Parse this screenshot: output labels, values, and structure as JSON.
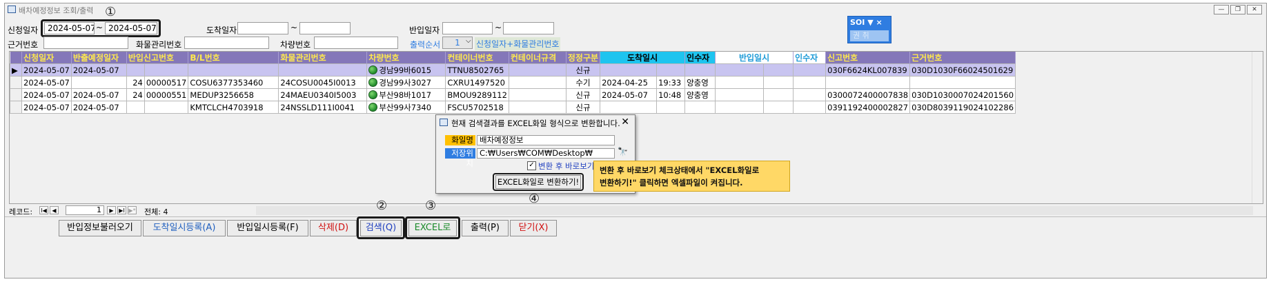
{
  "window": {
    "title": "배차예정정보 조회/출력",
    "controls": [
      "—",
      "❐",
      "✕"
    ]
  },
  "callouts": {
    "c1": "①",
    "c2": "②",
    "c3": "③",
    "c4": "④"
  },
  "filters": {
    "apply_date_label": "신청일자",
    "apply_date_from": "2024-05-07",
    "range_sep": "~",
    "apply_date_to": "2024-05-07",
    "arrival_date_label": "도착일자",
    "arrival_date_from": "",
    "arrival_date_to": "",
    "import_date_label": "반입일자",
    "import_date_from": "",
    "import_date_to": "",
    "basis_no_label": "근거번호",
    "basis_no": "",
    "cargo_mgmt_label": "화물관리번호",
    "cargo_mgmt": "",
    "vehicle_no_label": "차량번호",
    "vehicle_no": "",
    "print_order_label": "출력순서",
    "print_order_value": "1",
    "print_order_text": "신청일자+화물관리번호"
  },
  "soi_widget": {
    "title": "SOI",
    "caret": "▼",
    "close": "×",
    "hint": "권 취"
  },
  "grid": {
    "headers": [
      "신청일자",
      "반출예정일자",
      "반입신고번호",
      "B/L번호",
      "화물관리번호",
      "차량번호",
      "컨테이너번호",
      "컨테이너규격",
      "정정구분",
      "도착일시",
      "",
      "인수자",
      "반입일시",
      "",
      "인수자",
      "신고번호",
      "근거번호"
    ],
    "rows": [
      {
        "apply": "2024-05-07",
        "out": "2024-05-07",
        "imp_a": "",
        "imp_b": "",
        "bl": "",
        "cargo": "",
        "veh": "경남99바6015",
        "cont": "TTNU8502765",
        "spec": "",
        "corr": "신규",
        "arr_d": "",
        "arr_t": "",
        "recv": "",
        "in_d": "",
        "in_t": "",
        "recv2": "",
        "decl": "030F6624KL007839",
        "basis": "030D1030F66024501629"
      },
      {
        "apply": "2024-05-07",
        "out": "",
        "imp_a": "24",
        "imp_b": "00000517",
        "bl": "COSU6377353460",
        "cargo": "24COSU0045I0013",
        "veh": "경남99사3027",
        "cont": "CXRU1497520",
        "spec": "",
        "corr": "수기",
        "arr_d": "2024-04-25",
        "arr_t": "19:33",
        "recv": "양충영",
        "in_d": "",
        "in_t": "",
        "recv2": "",
        "decl": "",
        "basis": ""
      },
      {
        "apply": "2024-05-07",
        "out": "2024-05-07",
        "imp_a": "24",
        "imp_b": "00000551",
        "bl": "MEDUP3256658",
        "cargo": "24MAEU0340I5003",
        "veh": "부산98바1017",
        "cont": "BMOU9289112",
        "spec": "",
        "corr": "신규",
        "arr_d": "2024-05-07",
        "arr_t": "10:48",
        "recv": "양충영",
        "in_d": "",
        "in_t": "",
        "recv2": "",
        "decl": "0300072400007838",
        "basis": "030D1030007024201560"
      },
      {
        "apply": "2024-05-07",
        "out": "2024-05-07",
        "imp_a": "",
        "imp_b": "",
        "bl": "KMTCLCH4703918",
        "cargo": "24NSSLD111I0041",
        "veh": "부산99사7340",
        "cont": "FSCU5702518",
        "spec": "",
        "corr": "신규",
        "arr_d": "",
        "arr_t": "",
        "recv": "",
        "in_d": "",
        "in_t": "",
        "recv2": "",
        "decl": "0391192400002827",
        "basis": "030D8039119024102286"
      }
    ]
  },
  "record_nav": {
    "label": "레코드:",
    "first": "I◀",
    "prev": "◀",
    "current": "1",
    "next": "▶",
    "last": "▶I",
    "new": "▶*",
    "total": "전체: 4"
  },
  "dialog": {
    "title": "현재 검색결과를 EXCEL화일 형식으로 변환합니다.",
    "close": "✕",
    "filename_label": "화일명",
    "filename": "배차예정정보",
    "location_label": "저장위치",
    "location": "C:₩Users₩COM₩Desktop₩",
    "browse_icon": "🔭",
    "checkbox_label": "변환 후 바로보기",
    "checkbox_mark": "✓",
    "convert_button": "EXCEL화일로 변환하기!"
  },
  "tooltip": {
    "line1": "변환 후 바로보기 체크상태에서 \"EXCEL화일로",
    "line2": "변환하기!\" 클릭하면 엑셀파일이 켜집니다."
  },
  "buttons": {
    "load_import": "반입정보불러오기",
    "arrival_reg": "도착일시등록(A)",
    "import_reg": "반입일시등록(F)",
    "delete": "삭제(D)",
    "search": "검색(Q)",
    "excel": "EXCEL로",
    "print": "출력(P)",
    "close": "닫기(X)"
  },
  "colors": {
    "header_purple": "#8477b9",
    "header_cyan": "#1ec4ef",
    "header_yellow_text": "#ffe94d",
    "selected_row": "#c8c4f0",
    "tooltip_bg": "#ffd866",
    "label_highlight": "#ffc000",
    "label_blue": "#2f7de1"
  }
}
